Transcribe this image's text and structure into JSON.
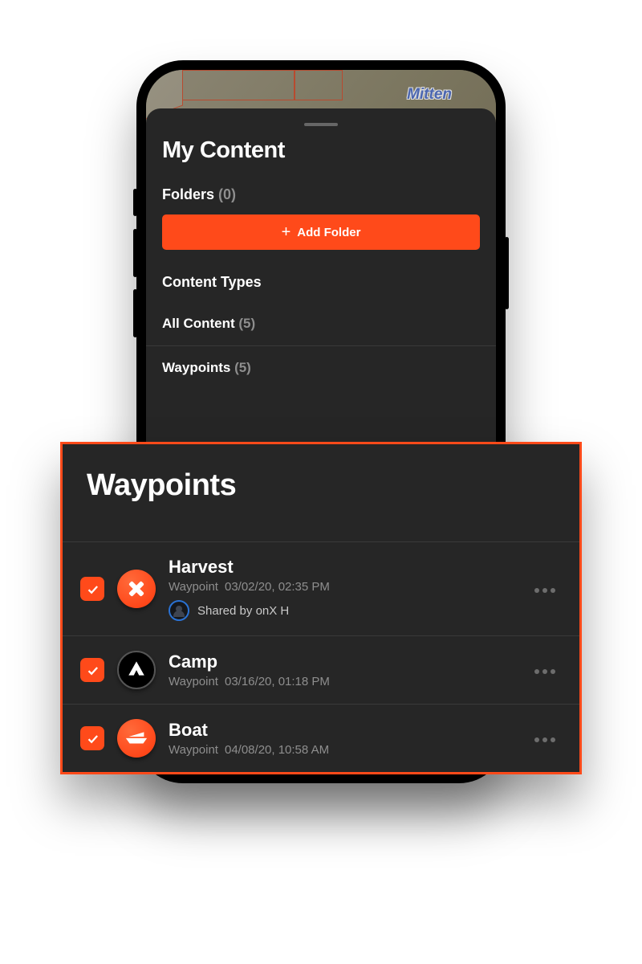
{
  "colors": {
    "accent": "#ff4a1a",
    "bg_dark": "#262626",
    "text_muted": "#8e8e8e"
  },
  "map": {
    "label": "Mitten"
  },
  "sheet": {
    "title": "My Content",
    "folders": {
      "label": "Folders",
      "count": "(0)"
    },
    "addFolder": "Add Folder",
    "contentTypesLabel": "Content Types",
    "rows": [
      {
        "label": "All Content",
        "count": "(5)"
      },
      {
        "label": "Waypoints",
        "count": "(5)"
      }
    ]
  },
  "overlay": {
    "title": "Waypoints",
    "typeLabel": "Waypoint",
    "sharedPrefix": "Shared by",
    "items": [
      {
        "name": "Harvest",
        "timestamp": "03/02/20, 02:35 PM",
        "icon": "x-icon",
        "iconStyle": "orange",
        "checked": true,
        "sharedBy": "onX H"
      },
      {
        "name": "Camp",
        "timestamp": "03/16/20, 01:18 PM",
        "icon": "tent-icon",
        "iconStyle": "black",
        "checked": true
      },
      {
        "name": "Boat",
        "timestamp": "04/08/20, 10:58 AM",
        "icon": "boat-icon",
        "iconStyle": "orange",
        "checked": true
      }
    ]
  }
}
